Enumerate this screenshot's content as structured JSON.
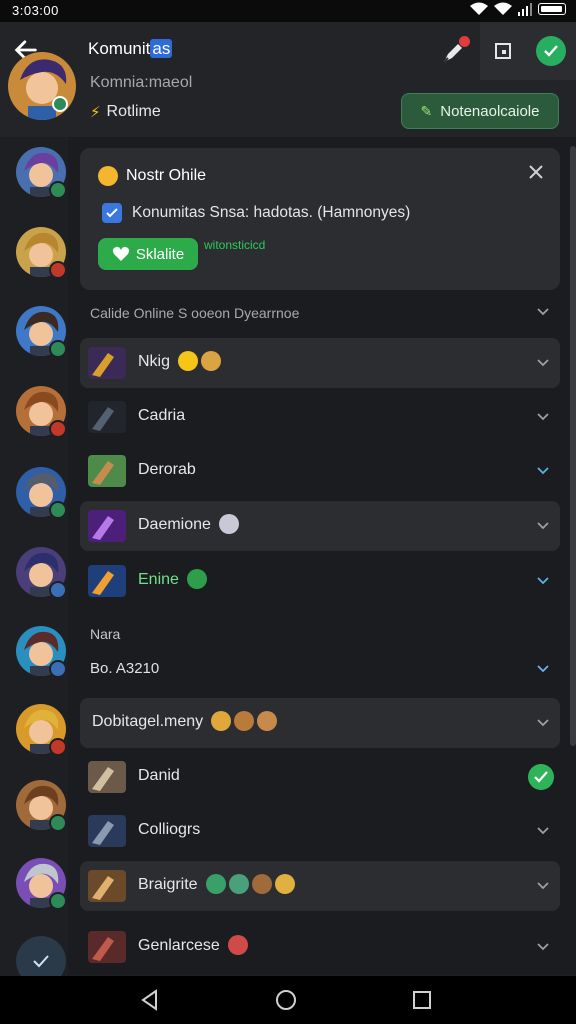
{
  "status_bar": {
    "time": "3:03:00"
  },
  "header": {
    "title_prefix": "Komunit",
    "title_highlight": "as",
    "subtitle": "Komnia:maeol",
    "status": "Rotlime",
    "notify_button": "Notenaolcaiole"
  },
  "banner": {
    "title": "Nostr Ohile",
    "line": "Konumitas Snsa: hadotas. (Hamnonyes)",
    "button": "Sklalite",
    "note": "witonsticicd"
  },
  "sections": [
    {
      "label": "Calide Online  S  ooeon Dyearrnoe"
    },
    {
      "label": "Nara"
    }
  ],
  "subheader": "Bo. A3210",
  "rows": [
    {
      "name": "Nkig"
    },
    {
      "name": "Cadria"
    },
    {
      "name": "Derorab"
    },
    {
      "name": "Daemione"
    },
    {
      "name": "Enine"
    },
    {
      "name": "Dobitagel.meny"
    },
    {
      "name": "Danid"
    },
    {
      "name": "Colliogrs"
    },
    {
      "name": "Braigrite"
    },
    {
      "name": "Genlarcese"
    }
  ],
  "colors": {
    "accent_green": "#2dab4b",
    "background": "#1b1c1f",
    "panel": "#2b2d31",
    "badge_red": "#e03c3c"
  }
}
